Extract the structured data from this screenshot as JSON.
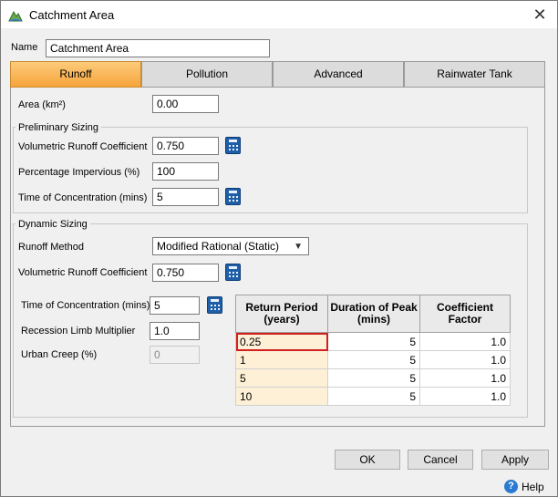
{
  "window": {
    "title": "Catchment Area",
    "close_glyph": "✕"
  },
  "name_field": {
    "label": "Name",
    "value": "Catchment Area"
  },
  "tabs": [
    "Runoff",
    "Pollution",
    "Advanced",
    "Rainwater Tank"
  ],
  "area": {
    "label": "Area (km²)",
    "value": "0.00"
  },
  "preliminary": {
    "title": "Preliminary Sizing",
    "vrc_label": "Volumetric Runoff Coefficient",
    "vrc_value": "0.750",
    "pi_label": "Percentage Impervious (%)",
    "pi_value": "100",
    "tc_label": "Time of Concentration (mins)",
    "tc_value": "5"
  },
  "dynamic": {
    "title": "Dynamic Sizing",
    "method_label": "Runoff Method",
    "method_value": "Modified Rational (Static)",
    "vrc_label": "Volumetric Runoff Coefficient",
    "vrc_value": "0.750",
    "tc_label": "Time of Concentration (mins)",
    "tc_value": "5",
    "rlm_label": "Recession Limb Multiplier",
    "rlm_value": "1.0",
    "uc_label": "Urban Creep (%)",
    "uc_value": "0"
  },
  "table": {
    "headers": [
      "Return Period (years)",
      "Duration of Peak (mins)",
      "Coefficient Factor"
    ],
    "rows": [
      [
        "0.25",
        "5",
        "1.0"
      ],
      [
        "1",
        "5",
        "1.0"
      ],
      [
        "5",
        "5",
        "1.0"
      ],
      [
        "10",
        "5",
        "1.0"
      ]
    ]
  },
  "buttons": {
    "ok": "OK",
    "cancel": "Cancel",
    "apply": "Apply",
    "help": "Help"
  },
  "icons": {
    "window": "catchment-icon",
    "calculator": "calculator-icon",
    "help": "help-icon"
  },
  "colors": {
    "active_tab": "#f7a43c",
    "selected_cell": "#d21f1f",
    "return_period_bg": "#fdf0d6"
  }
}
